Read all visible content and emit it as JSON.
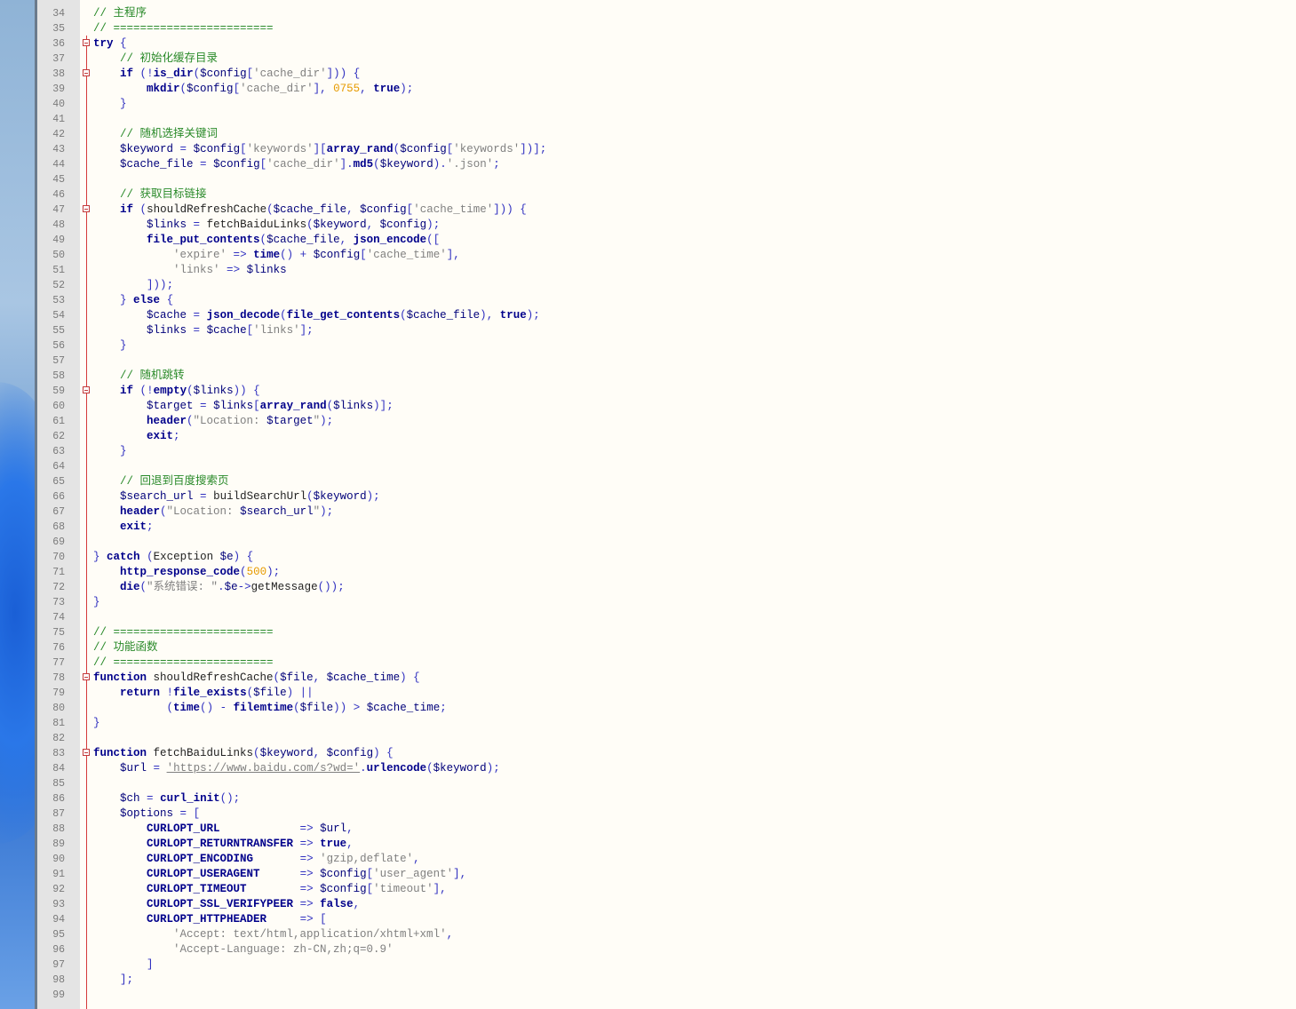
{
  "editor": {
    "lines": [
      {
        "n": "34",
        "fold": false,
        "text": "// 主程序"
      },
      {
        "n": "35",
        "fold": false,
        "text": "// ========================"
      },
      {
        "n": "36",
        "fold": true,
        "text": "try {"
      },
      {
        "n": "37",
        "fold": false,
        "text": "    // 初始化缓存目录"
      },
      {
        "n": "38",
        "fold": true,
        "text": "    if (!is_dir($config['cache_dir'])) {"
      },
      {
        "n": "39",
        "fold": false,
        "text": "        mkdir($config['cache_dir'], 0755, true);"
      },
      {
        "n": "40",
        "fold": false,
        "text": "    }"
      },
      {
        "n": "41",
        "fold": false,
        "text": ""
      },
      {
        "n": "42",
        "fold": false,
        "text": "    // 随机选择关键词"
      },
      {
        "n": "43",
        "fold": false,
        "text": "    $keyword = $config['keywords'][array_rand($config['keywords'])];"
      },
      {
        "n": "44",
        "fold": false,
        "text": "    $cache_file = $config['cache_dir'].md5($keyword).'.json';"
      },
      {
        "n": "45",
        "fold": false,
        "text": ""
      },
      {
        "n": "46",
        "fold": false,
        "text": "    // 获取目标链接"
      },
      {
        "n": "47",
        "fold": true,
        "text": "    if (shouldRefreshCache($cache_file, $config['cache_time'])) {"
      },
      {
        "n": "48",
        "fold": false,
        "text": "        $links = fetchBaiduLinks($keyword, $config);"
      },
      {
        "n": "49",
        "fold": false,
        "text": "        file_put_contents($cache_file, json_encode(["
      },
      {
        "n": "50",
        "fold": false,
        "text": "            'expire' => time() + $config['cache_time'],"
      },
      {
        "n": "51",
        "fold": false,
        "text": "            'links' => $links"
      },
      {
        "n": "52",
        "fold": false,
        "text": "        ]));"
      },
      {
        "n": "53",
        "fold": false,
        "text": "    } else {"
      },
      {
        "n": "54",
        "fold": false,
        "text": "        $cache = json_decode(file_get_contents($cache_file), true);"
      },
      {
        "n": "55",
        "fold": false,
        "text": "        $links = $cache['links'];"
      },
      {
        "n": "56",
        "fold": false,
        "text": "    }"
      },
      {
        "n": "57",
        "fold": false,
        "text": ""
      },
      {
        "n": "58",
        "fold": false,
        "text": "    // 随机跳转"
      },
      {
        "n": "59",
        "fold": true,
        "text": "    if (!empty($links)) {"
      },
      {
        "n": "60",
        "fold": false,
        "text": "        $target = $links[array_rand($links)];"
      },
      {
        "n": "61",
        "fold": false,
        "text": "        header(\"Location: $target\");"
      },
      {
        "n": "62",
        "fold": false,
        "text": "        exit;"
      },
      {
        "n": "63",
        "fold": false,
        "text": "    }"
      },
      {
        "n": "64",
        "fold": false,
        "text": ""
      },
      {
        "n": "65",
        "fold": false,
        "text": "    // 回退到百度搜索页"
      },
      {
        "n": "66",
        "fold": false,
        "text": "    $search_url = buildSearchUrl($keyword);"
      },
      {
        "n": "67",
        "fold": false,
        "text": "    header(\"Location: $search_url\");"
      },
      {
        "n": "68",
        "fold": false,
        "text": "    exit;"
      },
      {
        "n": "69",
        "fold": false,
        "text": ""
      },
      {
        "n": "70",
        "fold": false,
        "text": "} catch (Exception $e) {"
      },
      {
        "n": "71",
        "fold": false,
        "text": "    http_response_code(500);"
      },
      {
        "n": "72",
        "fold": false,
        "text": "    die(\"系统错误: \".$e->getMessage());"
      },
      {
        "n": "73",
        "fold": false,
        "text": "}"
      },
      {
        "n": "74",
        "fold": false,
        "text": ""
      },
      {
        "n": "75",
        "fold": false,
        "text": "// ========================"
      },
      {
        "n": "76",
        "fold": false,
        "text": "// 功能函数"
      },
      {
        "n": "77",
        "fold": false,
        "text": "// ========================"
      },
      {
        "n": "78",
        "fold": true,
        "text": "function shouldRefreshCache($file, $cache_time) {"
      },
      {
        "n": "79",
        "fold": false,
        "text": "    return !file_exists($file) ||"
      },
      {
        "n": "80",
        "fold": false,
        "text": "           (time() - filemtime($file)) > $cache_time;"
      },
      {
        "n": "81",
        "fold": false,
        "text": "}"
      },
      {
        "n": "82",
        "fold": false,
        "text": ""
      },
      {
        "n": "83",
        "fold": true,
        "text": "function fetchBaiduLinks($keyword, $config) {"
      },
      {
        "n": "84",
        "fold": false,
        "text": "    $url = 'https://www.baidu.com/s?wd='.urlencode($keyword);"
      },
      {
        "n": "85",
        "fold": false,
        "text": ""
      },
      {
        "n": "86",
        "fold": false,
        "text": "    $ch = curl_init();"
      },
      {
        "n": "87",
        "fold": false,
        "text": "    $options = ["
      },
      {
        "n": "88",
        "fold": false,
        "text": "        CURLOPT_URL            => $url,"
      },
      {
        "n": "89",
        "fold": false,
        "text": "        CURLOPT_RETURNTRANSFER => true,"
      },
      {
        "n": "90",
        "fold": false,
        "text": "        CURLOPT_ENCODING       => 'gzip,deflate',"
      },
      {
        "n": "91",
        "fold": false,
        "text": "        CURLOPT_USERAGENT      => $config['user_agent'],"
      },
      {
        "n": "92",
        "fold": false,
        "text": "        CURLOPT_TIMEOUT        => $config['timeout'],"
      },
      {
        "n": "93",
        "fold": false,
        "text": "        CURLOPT_SSL_VERIFYPEER => false,"
      },
      {
        "n": "94",
        "fold": false,
        "text": "        CURLOPT_HTTPHEADER     => ["
      },
      {
        "n": "95",
        "fold": false,
        "text": "            'Accept: text/html,application/xhtml+xml',"
      },
      {
        "n": "96",
        "fold": false,
        "text": "            'Accept-Language: zh-CN,zh;q=0.9'"
      },
      {
        "n": "97",
        "fold": false,
        "text": "        ]"
      },
      {
        "n": "98",
        "fold": false,
        "text": "    ];"
      },
      {
        "n": "99",
        "fold": false,
        "text": ""
      }
    ]
  }
}
